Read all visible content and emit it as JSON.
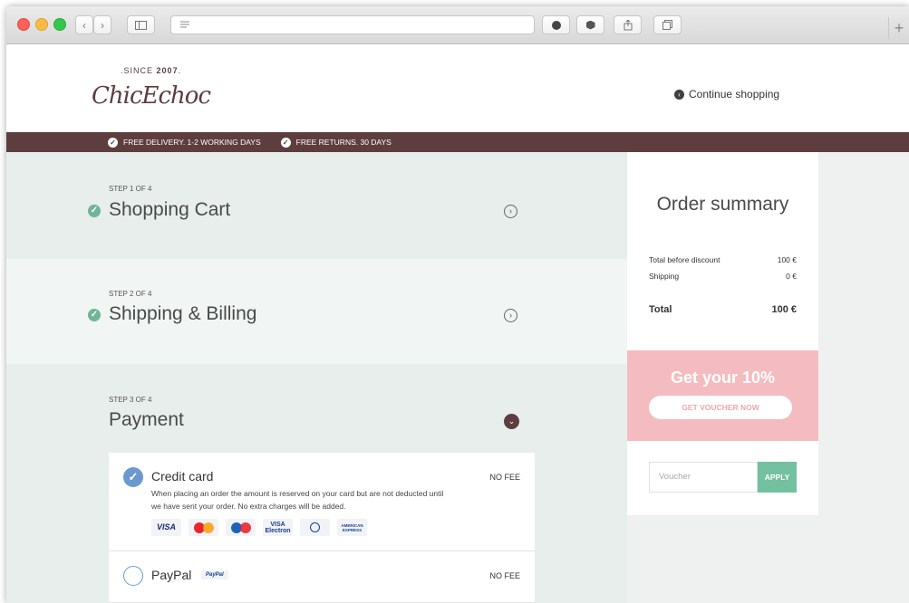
{
  "browser": {
    "newtab_label": "+"
  },
  "header": {
    "logo_since": "SINCE",
    "logo_year": "2007",
    "logo_word": "ChicEchoc",
    "continue_label": "Continue shopping"
  },
  "promo": {
    "items": [
      "FREE DELIVERY. 1-2 WORKING DAYS",
      "FREE RETURNS. 30 DAYS"
    ]
  },
  "steps": [
    {
      "label": "STEP 1 OF 4",
      "title": "Shopping Cart"
    },
    {
      "label": "STEP 2 OF 4",
      "title": "Shipping & Billing"
    },
    {
      "label": "STEP 3 OF 4",
      "title": "Payment"
    }
  ],
  "payment": {
    "credit_card": {
      "name": "Credit card",
      "fee": "NO FEE",
      "description": "When placing an order the amount is reserved on your card but are not deducted until we have sent your order. No extra charges will be added.",
      "cards": [
        "VISA",
        "MasterCard",
        "Maestro",
        "VISA Electron",
        "Diners Club",
        "AMERICAN EXPRESS"
      ],
      "selected": true
    },
    "paypal": {
      "name": "PayPal",
      "fee": "NO FEE",
      "logo": "PayPal",
      "selected": false
    }
  },
  "summary": {
    "title": "Order summary",
    "before_discount_label": "Total before discount",
    "before_discount_value": "100 €",
    "shipping_label": "Shipping",
    "shipping_value": "0 €",
    "total_label": "Total",
    "total_value": "100 €"
  },
  "voucher_promo": {
    "title": "Get your 10%",
    "button": "GET VOUCHER NOW"
  },
  "voucher": {
    "placeholder": "Voucher",
    "apply": "APPLY"
  },
  "colors": {
    "brand": "#5e3d3f",
    "accent_green": "#73c1a0",
    "promo_pink": "#f4bcc0",
    "radio_blue": "#6c98d0"
  }
}
